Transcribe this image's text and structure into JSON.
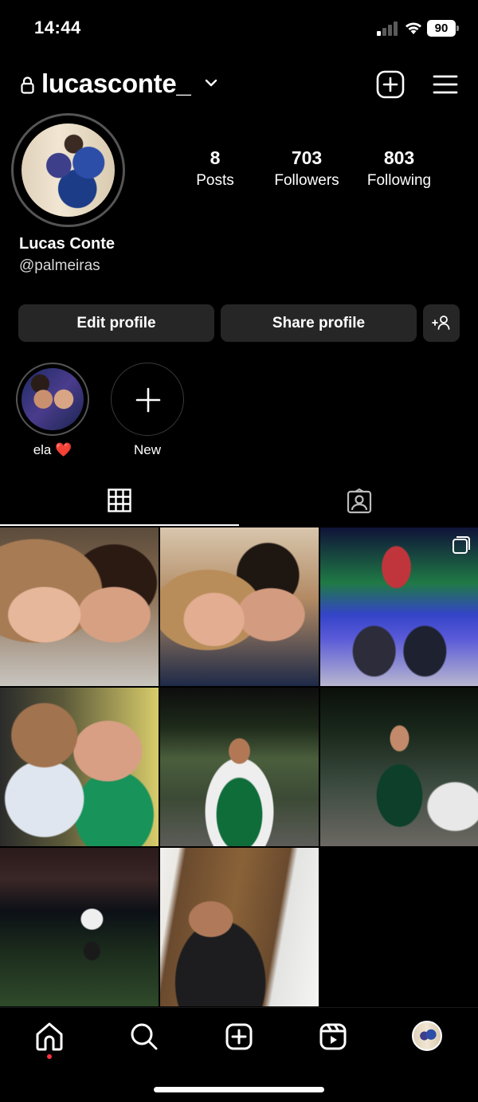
{
  "status_bar": {
    "time": "14:44",
    "battery": "90",
    "icons": [
      "signal-icon",
      "wifi-icon",
      "battery-icon"
    ]
  },
  "header": {
    "username": "lucasconte_",
    "icons": [
      "lock-icon",
      "chevron-down-icon",
      "add-post-icon",
      "menu-icon"
    ]
  },
  "profile": {
    "full_name": "Lucas Conte",
    "handle": "@palmeiras",
    "stats": {
      "posts": {
        "value": "8",
        "label": "Posts"
      },
      "followers": {
        "value": "703",
        "label": "Followers"
      },
      "following": {
        "value": "803",
        "label": "Following"
      }
    }
  },
  "actions": {
    "edit_label": "Edit profile",
    "share_label": "Share profile"
  },
  "highlights": [
    {
      "label": "ela ❤️"
    },
    {
      "label": "New"
    }
  ],
  "tabs": [
    "grid-icon",
    "tagged-icon"
  ],
  "posts_count_shown": 8,
  "bottom_nav": [
    "home-icon",
    "search-icon",
    "create-icon",
    "reels-icon",
    "profile-avatar"
  ],
  "colors": {
    "background": "#000000",
    "button": "#262626",
    "notification_dot": "#ff3040"
  }
}
